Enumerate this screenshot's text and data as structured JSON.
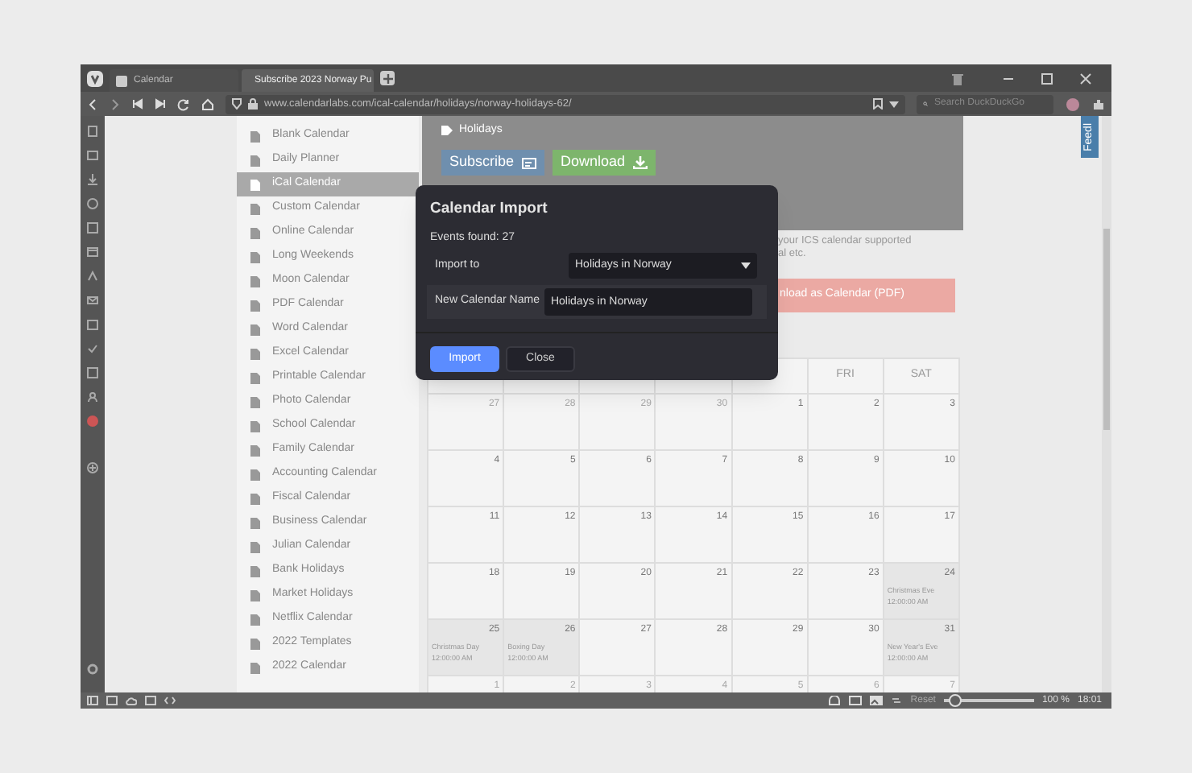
{
  "tabs": [
    {
      "title": "Calendar",
      "selected": false
    },
    {
      "title": "Subscribe 2023 Norway Pu",
      "selected": true
    }
  ],
  "address_bar": {
    "url": "www.calendarlabs.com/ical-calendar/holidays/norway-holidays-62/"
  },
  "search": {
    "placeholder": "Search DuckDuckGo"
  },
  "sidebar": {
    "items": [
      {
        "label": "Blank Calendar",
        "selected": false
      },
      {
        "label": "Daily Planner",
        "selected": false
      },
      {
        "label": "iCal Calendar",
        "selected": true
      },
      {
        "label": "Custom Calendar",
        "selected": false
      },
      {
        "label": "Online Calendar",
        "selected": false
      },
      {
        "label": "Long Weekends",
        "selected": false
      },
      {
        "label": "Moon Calendar",
        "selected": false
      },
      {
        "label": "PDF Calendar",
        "selected": false
      },
      {
        "label": "Word Calendar",
        "selected": false
      },
      {
        "label": "Excel Calendar",
        "selected": false
      },
      {
        "label": "Printable Calendar",
        "selected": false
      },
      {
        "label": "Photo Calendar",
        "selected": false
      },
      {
        "label": "School Calendar",
        "selected": false
      },
      {
        "label": "Family Calendar",
        "selected": false
      },
      {
        "label": "Accounting Calendar",
        "selected": false
      },
      {
        "label": "Fiscal Calendar",
        "selected": false
      },
      {
        "label": "Business Calendar",
        "selected": false
      },
      {
        "label": "Julian Calendar",
        "selected": false
      },
      {
        "label": "Bank Holidays",
        "selected": false
      },
      {
        "label": "Market Holidays",
        "selected": false
      },
      {
        "label": "Netflix Calendar",
        "selected": false
      },
      {
        "label": "2022 Templates",
        "selected": false
      },
      {
        "label": "2022 Calendar",
        "selected": false
      }
    ]
  },
  "banner": {
    "tag": "Holidays",
    "buttons": [
      {
        "label": "Subscribe",
        "kind": "subscribe"
      },
      {
        "label": "Download",
        "kind": "download"
      }
    ]
  },
  "description": [
    "your ICS calendar supported",
    "al etc."
  ],
  "pdf_button": "nload as Calendar (PDF)",
  "dialog": {
    "title": "Calendar Import",
    "events_found": "Events found: 27",
    "import_to": {
      "label": "Import to",
      "value": "Holidays in Norway"
    },
    "new_name": {
      "label": "New Calendar Name",
      "value": "Holidays in Norway"
    },
    "buttons": [
      {
        "label": "Import",
        "kind": "primary"
      },
      {
        "label": "Close",
        "kind": "secondary"
      }
    ]
  },
  "calendar": {
    "visible_headers": [
      "FRI",
      "SAT"
    ],
    "weeks": [
      [
        {
          "day": "27",
          "other_month": true
        },
        {
          "day": "28",
          "other_month": true
        },
        {
          "day": "29",
          "other_month": true
        },
        {
          "day": "30",
          "other_month": true
        },
        {
          "day": "1",
          "other_month": false
        },
        {
          "day": "2",
          "other_month": false
        },
        {
          "day": "3",
          "other_month": false
        }
      ],
      [
        {
          "day": "4",
          "other_month": false
        },
        {
          "day": "5",
          "other_month": false
        },
        {
          "day": "6",
          "other_month": false
        },
        {
          "day": "7",
          "other_month": false
        },
        {
          "day": "8",
          "other_month": false
        },
        {
          "day": "9",
          "other_month": false
        },
        {
          "day": "10",
          "other_month": false
        }
      ],
      [
        {
          "day": "11",
          "other_month": false
        },
        {
          "day": "12",
          "other_month": false
        },
        {
          "day": "13",
          "other_month": false
        },
        {
          "day": "14",
          "other_month": false
        },
        {
          "day": "15",
          "other_month": false
        },
        {
          "day": "16",
          "other_month": false
        },
        {
          "day": "17",
          "other_month": false
        }
      ],
      [
        {
          "day": "18",
          "other_month": false
        },
        {
          "day": "19",
          "other_month": false
        },
        {
          "day": "20",
          "other_month": false
        },
        {
          "day": "21",
          "other_month": false
        },
        {
          "day": "22",
          "other_month": false
        },
        {
          "day": "23",
          "other_month": false
        },
        {
          "day": "24",
          "other_month": false,
          "event": {
            "name": "Christmas Eve",
            "time": "12:00:00 AM"
          }
        }
      ],
      [
        {
          "day": "25",
          "other_month": false,
          "event": {
            "name": "Christmas Day",
            "time": "12:00:00 AM"
          }
        },
        {
          "day": "26",
          "other_month": false,
          "event": {
            "name": "Boxing Day",
            "time": "12:00:00 AM"
          }
        },
        {
          "day": "27",
          "other_month": false
        },
        {
          "day": "28",
          "other_month": false
        },
        {
          "day": "29",
          "other_month": false
        },
        {
          "day": "30",
          "other_month": false
        },
        {
          "day": "31",
          "other_month": false,
          "event": {
            "name": "New Year's Eve",
            "time": "12:00:00 AM"
          }
        }
      ],
      [
        {
          "day": "1",
          "other_month": true
        },
        {
          "day": "2",
          "other_month": true
        },
        {
          "day": "3",
          "other_month": true
        },
        {
          "day": "4",
          "other_month": true
        },
        {
          "day": "5",
          "other_month": true
        },
        {
          "day": "6",
          "other_month": true
        },
        {
          "day": "7",
          "other_month": true
        }
      ]
    ]
  },
  "feedback_tab": "Feedl",
  "status_bar": {
    "reset": "Reset",
    "zoom": {
      "level": 0.12,
      "reading": "100 %"
    },
    "clock": "18:01"
  }
}
